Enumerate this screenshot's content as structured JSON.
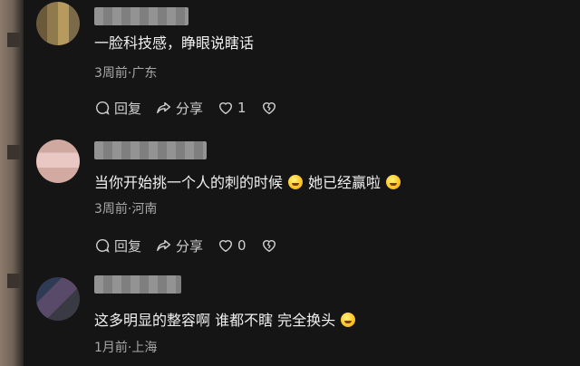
{
  "comments": [
    {
      "text": "一脸科技感，睁眼说瞎话",
      "meta": "3周前·广东",
      "actions": {
        "reply": "回复",
        "share": "分享",
        "likes": "1"
      }
    },
    {
      "text_part1": "当你开始挑一个人的刺的时候",
      "text_part2": "她已经赢啦",
      "meta": "3周前·河南",
      "actions": {
        "reply": "回复",
        "share": "分享",
        "likes": "0"
      }
    },
    {
      "text": "这多明显的整容啊 谁都不瞎 完全换头",
      "meta": "1月前·上海"
    }
  ],
  "icons": {
    "reply": "reply-icon",
    "share": "share-icon",
    "like": "heart-icon",
    "dislike": "broken-heart-icon"
  },
  "colors": {
    "background": "#151515",
    "text": "#f0f0f0",
    "meta": "#a8a8a8",
    "action": "#cfcfcf"
  }
}
